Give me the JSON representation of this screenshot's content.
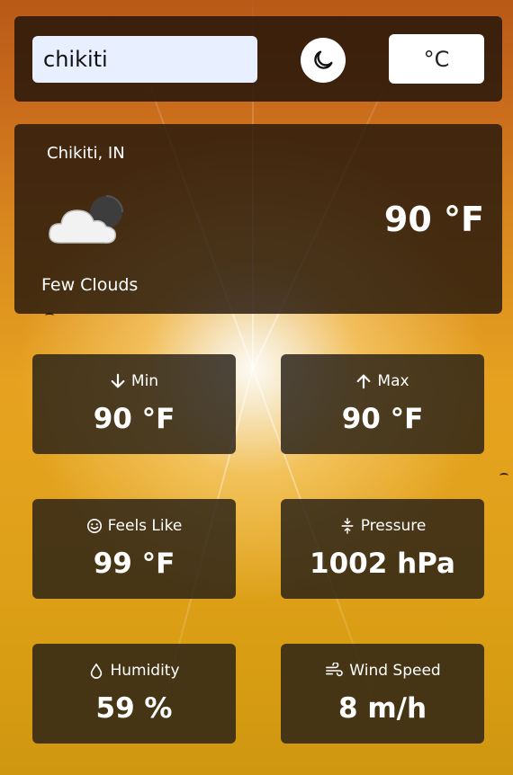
{
  "search": {
    "value": "chikiti"
  },
  "theme_toggle": {
    "icon": "moon-icon"
  },
  "unit_toggle": {
    "label": "°C"
  },
  "current": {
    "location": "Chikiti, IN",
    "icon": "few-clouds-night-icon",
    "condition": "Few Clouds",
    "temperature": "90 °F"
  },
  "stats": {
    "min": {
      "label": "Min",
      "icon": "arrow-down-icon",
      "value": "90 °F"
    },
    "max": {
      "label": "Max",
      "icon": "arrow-up-icon",
      "value": "90 °F"
    },
    "feels_like": {
      "label": "Feels Like",
      "icon": "smile-icon",
      "value": "99 °F"
    },
    "pressure": {
      "label": "Pressure",
      "icon": "pressure-icon",
      "value": "1002 hPa"
    },
    "humidity": {
      "label": "Humidity",
      "icon": "droplet-icon",
      "value": "59 %"
    },
    "wind_speed": {
      "label": "Wind Speed",
      "icon": "wind-icon",
      "value": "8 m/h"
    }
  }
}
